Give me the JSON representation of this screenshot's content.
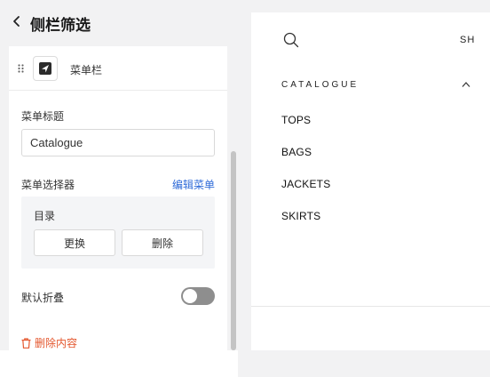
{
  "header": {
    "title": "侧栏筛选"
  },
  "menu_block": {
    "label": "菜单栏"
  },
  "menu_title": {
    "label": "菜单标题",
    "value": "Catalogue"
  },
  "menu_selector": {
    "label": "菜单选择器",
    "edit_link": "编辑菜单",
    "current_value": "目录",
    "replace_button": "更换",
    "delete_button": "删除"
  },
  "collapse_setting": {
    "label": "默认折叠",
    "enabled": false
  },
  "delete_content": {
    "label": "删除内容"
  },
  "preview": {
    "top_text": "SH",
    "section_heading": "CATALOGUE",
    "items": [
      "TOPS",
      "BAGS",
      "JACKETS",
      "SKIRTS"
    ]
  },
  "colors": {
    "link": "#2f6bd8",
    "danger": "#e4572e",
    "toggle_off": "#8e8e8e"
  },
  "icons": {
    "back": "chevron-left-icon",
    "drag": "drag-handle-icon",
    "menu": "arrow-square-icon",
    "delete": "trash-icon",
    "search": "search-icon",
    "collapse": "chevron-up-icon"
  }
}
